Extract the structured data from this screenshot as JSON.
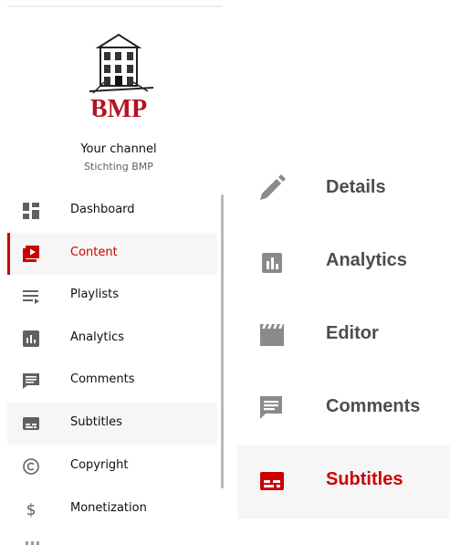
{
  "channel": {
    "logo_text": "BMP",
    "title": "Your channel",
    "name": "Stichting BMP"
  },
  "sidebar": {
    "items": [
      {
        "label": "Dashboard",
        "icon": "dashboard-icon"
      },
      {
        "label": "Content",
        "icon": "content-play-icon",
        "active": true
      },
      {
        "label": "Playlists",
        "icon": "playlists-icon"
      },
      {
        "label": "Analytics",
        "icon": "analytics-icon"
      },
      {
        "label": "Comments",
        "icon": "comments-icon"
      },
      {
        "label": "Subtitles",
        "icon": "subtitles-icon",
        "highlight": true
      },
      {
        "label": "Copyright",
        "icon": "copyright-icon"
      },
      {
        "label": "Monetization",
        "icon": "dollar-icon"
      }
    ]
  },
  "video_menu": {
    "items": [
      {
        "label": "Details",
        "icon": "pencil-icon"
      },
      {
        "label": "Analytics",
        "icon": "analytics-icon"
      },
      {
        "label": "Editor",
        "icon": "clapperboard-icon"
      },
      {
        "label": "Comments",
        "icon": "comments-icon"
      },
      {
        "label": "Subtitles",
        "icon": "subtitles-icon",
        "active": true
      }
    ]
  },
  "colors": {
    "accent": "#cc0000",
    "icon_gray": "#606060",
    "right_icon_gray": "#8a8a8a",
    "active_bg": "#f6f6f6"
  }
}
